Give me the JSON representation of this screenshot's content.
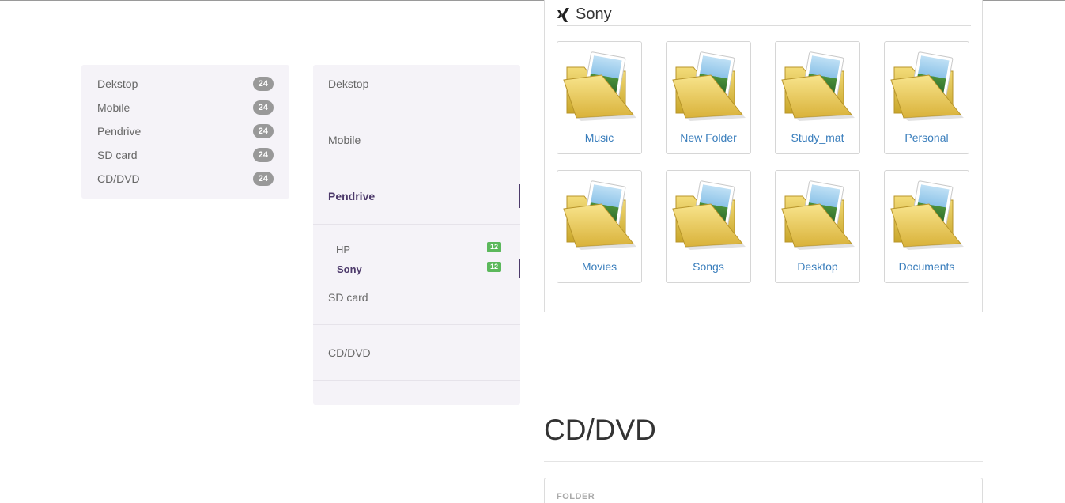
{
  "list_simple": {
    "items": [
      {
        "label": "Dekstop",
        "count": "24"
      },
      {
        "label": "Mobile",
        "count": "24"
      },
      {
        "label": "Pendrive",
        "count": "24"
      },
      {
        "label": "SD card",
        "count": "24"
      },
      {
        "label": "CD/DVD",
        "count": "24"
      }
    ]
  },
  "nav": {
    "items": [
      {
        "label": "Dekstop"
      },
      {
        "label": "Mobile"
      },
      {
        "label": "Pendrive"
      },
      {
        "label": "SD card"
      },
      {
        "label": "CD/DVD"
      }
    ],
    "sub_items": [
      {
        "label": "HP",
        "count": "12"
      },
      {
        "label": "Sony",
        "count": "12"
      }
    ]
  },
  "panel": {
    "title": "Sony",
    "title_icon": "xing-icon",
    "folders": [
      {
        "name": "Music"
      },
      {
        "name": "New Folder"
      },
      {
        "name": "Study_mat"
      },
      {
        "name": "Personal"
      },
      {
        "name": "Movies"
      },
      {
        "name": "Songs"
      },
      {
        "name": "Desktop"
      },
      {
        "name": "Documents"
      }
    ]
  },
  "section": {
    "title": "CD/DVD",
    "folder_label": "FOLDER"
  },
  "colors": {
    "accent": "#4d3a6b",
    "link": "#3a7ebc",
    "badge_gray": "#999999",
    "badge_green": "#5cb85c",
    "list_bg": "#f5f3f8"
  }
}
